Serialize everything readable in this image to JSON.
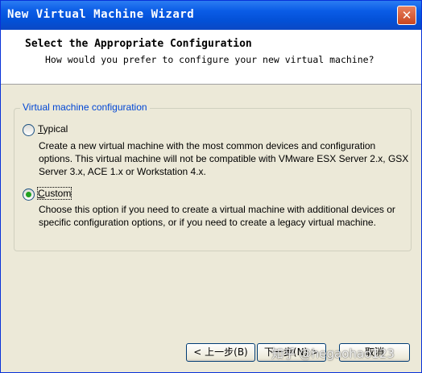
{
  "window": {
    "title": "New Virtual Machine Wizard",
    "close_glyph": "✕"
  },
  "header": {
    "title": "Select the Appropriate Configuration",
    "description": "How would you prefer to configure your new virtual machine?"
  },
  "group": {
    "legend": "Virtual machine configuration",
    "options": [
      {
        "label_accel": "T",
        "label_rest": "ypical",
        "selected": false,
        "description": "Create a new virtual machine with the most common devices and configuration options. This virtual machine will not be compatible with VMware ESX Server 2.x, GSX Server 3.x, ACE 1.x or Workstation 4.x."
      },
      {
        "label_accel": "C",
        "label_rest": "ustom",
        "selected": true,
        "description": "Choose this option if you need to create a virtual machine with additional devices or specific configuration options, or if you need to create a legacy virtual machine."
      }
    ]
  },
  "buttons": {
    "back": "< 上一步(B)",
    "next": "下一步(N) >",
    "cancel": "取消"
  },
  "watermark": "知乎 @hegaohao123",
  "colors": {
    "titlebar": "#0a5ce6",
    "legend": "#0046d5",
    "radio_dot": "#21a121",
    "dialog_bg": "#ece9d8"
  }
}
